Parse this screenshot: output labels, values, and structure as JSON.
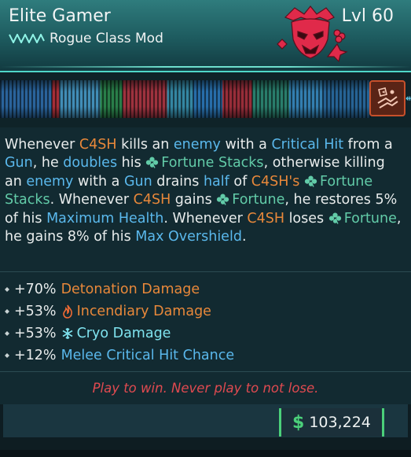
{
  "item": {
    "name": "Elite Gamer",
    "level": "Lvl 60",
    "type": "Rogue Class Mod",
    "rarity_color": "#4fd7c8"
  },
  "description": {
    "segments": [
      {
        "text": "Whenever ",
        "style": "plain"
      },
      {
        "text": "C4SH",
        "style": "orange"
      },
      {
        "text": " kills an ",
        "style": "plain"
      },
      {
        "text": "enemy",
        "style": "blue"
      },
      {
        "text": " with a ",
        "style": "plain"
      },
      {
        "text": "Critical Hit",
        "style": "blue"
      },
      {
        "text": " from a ",
        "style": "plain"
      },
      {
        "text": "Gun",
        "style": "blue"
      },
      {
        "text": ", he ",
        "style": "plain"
      },
      {
        "text": "doubles",
        "style": "blue"
      },
      {
        "text": " his ",
        "style": "plain"
      },
      {
        "text": "Fortune Stacks",
        "style": "green",
        "icon": "clover-icon"
      },
      {
        "text": ", otherwise killing an ",
        "style": "plain"
      },
      {
        "text": "enemy",
        "style": "blue"
      },
      {
        "text": " with a ",
        "style": "plain"
      },
      {
        "text": "Gun",
        "style": "blue"
      },
      {
        "text": " drains ",
        "style": "plain"
      },
      {
        "text": "half",
        "style": "blue"
      },
      {
        "text": " of ",
        "style": "plain"
      },
      {
        "text": "C4SH's",
        "style": "orange"
      },
      {
        "text": " ",
        "style": "plain"
      },
      {
        "text": "Fortune Stacks",
        "style": "green",
        "icon": "clover-icon"
      },
      {
        "text": ". Whenever ",
        "style": "plain"
      },
      {
        "text": "C4SH",
        "style": "orange"
      },
      {
        "text": " gains ",
        "style": "plain"
      },
      {
        "text": "Fortune",
        "style": "green",
        "icon": "clover-icon"
      },
      {
        "text": ", he restores 5% of his ",
        "style": "plain"
      },
      {
        "text": "Maximum Health",
        "style": "blue"
      },
      {
        "text": ". Whenever ",
        "style": "plain"
      },
      {
        "text": "C4SH",
        "style": "orange"
      },
      {
        "text": " loses ",
        "style": "plain"
      },
      {
        "text": "Fortune",
        "style": "green",
        "icon": "clover-icon"
      },
      {
        "text": ", he gains 8% of his ",
        "style": "plain"
      },
      {
        "text": "Max Overshield",
        "style": "blue"
      },
      {
        "text": ".",
        "style": "plain"
      }
    ]
  },
  "stats": [
    {
      "value": "+70%",
      "name": "Detonation Damage",
      "style": "orange",
      "icon": ""
    },
    {
      "value": "+53%",
      "name": "Incendiary Damage",
      "style": "orange",
      "icon": "flame-icon"
    },
    {
      "value": "+53%",
      "name": "Cryo Damage",
      "style": "cyan",
      "icon": "snowflake-icon"
    },
    {
      "value": "+12%",
      "name": "Melee Critical Hit Chance",
      "style": "blue",
      "icon": ""
    }
  ],
  "flavor_text": "Play to win. Never play to not lose.",
  "price": {
    "currency_icon": "dollar-icon",
    "symbol": "$",
    "value": "103,224",
    "accent": "#4bd07a"
  },
  "skill_icon": "hand-cards-icon"
}
